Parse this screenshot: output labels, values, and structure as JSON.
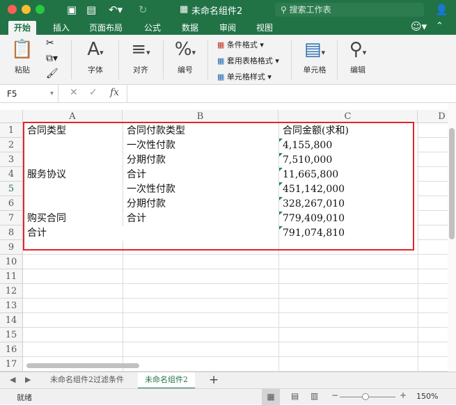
{
  "window": {
    "title": "未命名组件2",
    "search_placeholder": "搜索工作表"
  },
  "ribbon_tabs": [
    "开始",
    "插入",
    "页面布局",
    "公式",
    "数据",
    "审阅",
    "视图"
  ],
  "ribbon": {
    "paste": "粘贴",
    "font": "字体",
    "align": "对齐",
    "number": "编号",
    "cond_format": "条件格式",
    "table_format": "套用表格格式",
    "cell_style": "单元格样式",
    "cells": "单元格",
    "edit": "编辑"
  },
  "formula_bar": {
    "name_box": "F5",
    "fx": "fx",
    "value": ""
  },
  "columns": [
    "A",
    "B",
    "C",
    "D"
  ],
  "rows": [
    "1",
    "2",
    "3",
    "4",
    "5",
    "6",
    "7",
    "8",
    "9",
    "10",
    "11",
    "12",
    "13",
    "14",
    "15",
    "16",
    "17"
  ],
  "selected_row": "5",
  "cells": {
    "a1": "合同类型",
    "b1": "合同付款类型",
    "c1": "合同金额(求和)",
    "b2": "一次性付款",
    "c2": "4,155,800",
    "b3": "分期付款",
    "c3": "7,510,000",
    "a4": "服务协议",
    "b4": "合计",
    "c4": "11,665,800",
    "b5": "一次性付款",
    "c5": "451,142,000",
    "b6": "分期付款",
    "c6": "328,267,010",
    "a7": "购买合同",
    "b7": "合计",
    "c7": "779,409,010",
    "a8": "合计",
    "c8": "791,074,810"
  },
  "sheet_tabs": [
    "未命名组件2过滤条件",
    "未命名组件2"
  ],
  "active_sheet": 1,
  "status": {
    "ready": "就绪",
    "zoom": "150%"
  },
  "colors": {
    "brand": "#217346",
    "highlight": "#e3242b"
  }
}
